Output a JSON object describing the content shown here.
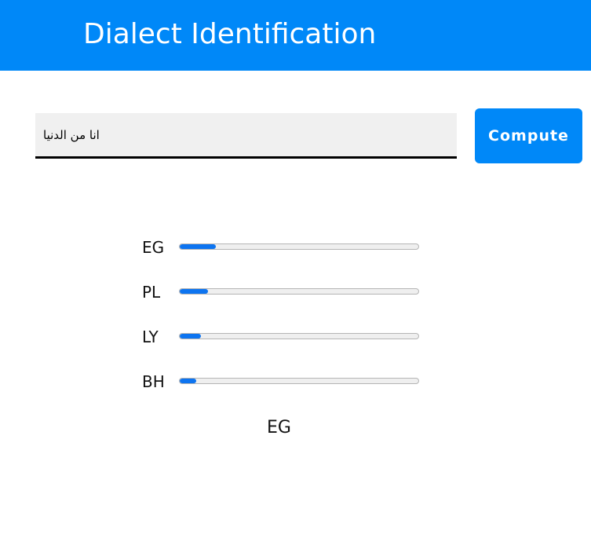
{
  "header": {
    "title": "Dialect Identification"
  },
  "input": {
    "value": "انا من الدنيا"
  },
  "compute_button": {
    "label": "Compute"
  },
  "results": [
    {
      "label": "EG",
      "fraction": 0.15
    },
    {
      "label": "PL",
      "fraction": 0.12
    },
    {
      "label": "LY",
      "fraction": 0.09
    },
    {
      "label": "BH",
      "fraction": 0.07
    }
  ],
  "prediction": "EG",
  "colors": {
    "header_bg": "#0088f8",
    "button_bg": "#0088f8",
    "bar_fill": "#0d74f0",
    "bar_track": "#efefef"
  }
}
